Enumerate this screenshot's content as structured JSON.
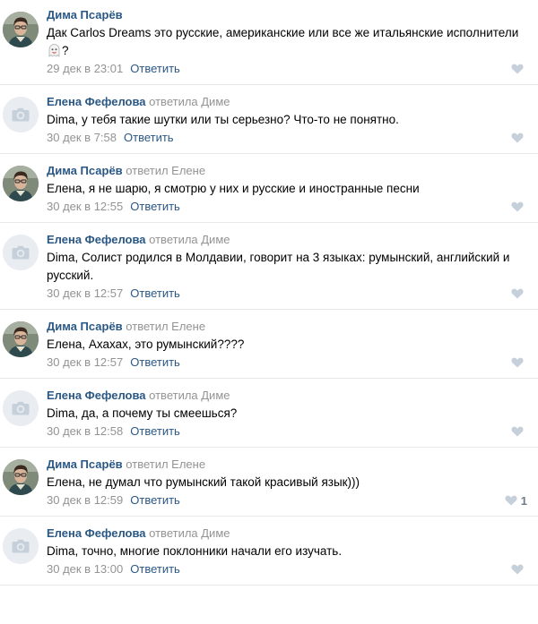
{
  "comments": [
    {
      "author": "Дима Псарёв",
      "reply_to": "",
      "text": "Дак Carlos Dreams это русские, американские или все же итальянские исполнители",
      "text_suffix": "?",
      "has_sticker": true,
      "date": "29 дек в 23:01",
      "reply_label": "Ответить",
      "avatar": "photo",
      "likes": ""
    },
    {
      "author": "Елена Фефелова",
      "reply_to": "ответила Диме",
      "text": "Dima, у тебя такие шутки или ты серьезно? Что-то не понятно.",
      "date": "30 дек в 7:58",
      "reply_label": "Ответить",
      "avatar": "camera",
      "likes": ""
    },
    {
      "author": "Дима Псарёв",
      "reply_to": "ответил Елене",
      "text": "Елена, я не шарю, я смотрю у них и русские и иностранные песни",
      "date": "30 дек в 12:55",
      "reply_label": "Ответить",
      "avatar": "photo",
      "likes": ""
    },
    {
      "author": "Елена Фефелова",
      "reply_to": "ответила Диме",
      "text": "Dima, Солист родился в Молдавии, говорит на 3 языках: румынский, английский и русский.",
      "date": "30 дек в 12:57",
      "reply_label": "Ответить",
      "avatar": "camera",
      "likes": ""
    },
    {
      "author": "Дима Псарёв",
      "reply_to": "ответил Елене",
      "text": "Елена, Ахахах, это румынский????",
      "date": "30 дек в 12:57",
      "reply_label": "Ответить",
      "avatar": "photo",
      "likes": ""
    },
    {
      "author": "Елена Фефелова",
      "reply_to": "ответила Диме",
      "text": "Dima, да, а почему ты смеешься?",
      "date": "30 дек в 12:58",
      "reply_label": "Ответить",
      "avatar": "camera",
      "likes": ""
    },
    {
      "author": "Дима Псарёв",
      "reply_to": "ответил Елене",
      "text": "Елена, не думал что румынский такой красивый язык)))",
      "date": "30 дек в 12:59",
      "reply_label": "Ответить",
      "avatar": "photo",
      "likes": "1"
    },
    {
      "author": "Елена Фефелова",
      "reply_to": "ответила Диме",
      "text": "Dima, точно, многие поклонники начали его изучать.",
      "date": "30 дек в 13:00",
      "reply_label": "Ответить",
      "avatar": "camera",
      "likes": ""
    }
  ],
  "colors": {
    "author": "#2a5885",
    "muted": "#939393",
    "heart": "#c5d0db",
    "divider": "#e7e8ec"
  },
  "icons": {
    "like": "heart-icon",
    "avatar_placeholder": "camera-icon"
  }
}
